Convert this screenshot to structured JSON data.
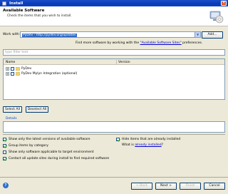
{
  "window": {
    "title": "Install",
    "close_glyph": "×"
  },
  "banner": {
    "title": "Available Software",
    "description": "Check the items that you wish to install."
  },
  "work_with": {
    "label": "Work with:",
    "value": "PyDev - http://pydev.org/updates",
    "arrow": "▼",
    "add_label": "Add..."
  },
  "find_more": {
    "prefix": "Find more software by working with the ",
    "link": "\"Available Software Sites\"",
    "suffix": " preferences."
  },
  "filter": {
    "placeholder": "type filter text"
  },
  "table": {
    "columns": [
      "Name",
      "Version"
    ],
    "rows": [
      {
        "expander": "+",
        "label": "PyDev",
        "checked": false
      },
      {
        "expander": "+",
        "label": "PyDev Mylyn Integration (optional)",
        "checked": false
      }
    ]
  },
  "buttons": {
    "select_all": "Select All",
    "deselect_all": "Deselect All"
  },
  "details": {
    "label": "Details"
  },
  "options": {
    "show_latest": {
      "label": "Show only the latest versions of available software",
      "checked": true
    },
    "hide_installed": {
      "label": "Hide items that are already installed",
      "checked": true
    },
    "group_by_category": {
      "label": "Group items by category",
      "checked": true
    },
    "what_is": {
      "prefix": "What is ",
      "link": "already installed",
      "suffix": "?"
    },
    "show_applicable": {
      "label": "Show only software applicable to target environment",
      "checked": false
    },
    "contact_sites": {
      "label": "Contact all update sites during install to find required software",
      "checked": true
    }
  },
  "footer": {
    "help_glyph": "?",
    "back": "< Back",
    "next": "Next >",
    "finish": "Finish",
    "cancel": "Cancel"
  },
  "colors": {
    "titlebar": "#0a3bb7",
    "selection": "#316ac5",
    "link": "#0000cc"
  }
}
